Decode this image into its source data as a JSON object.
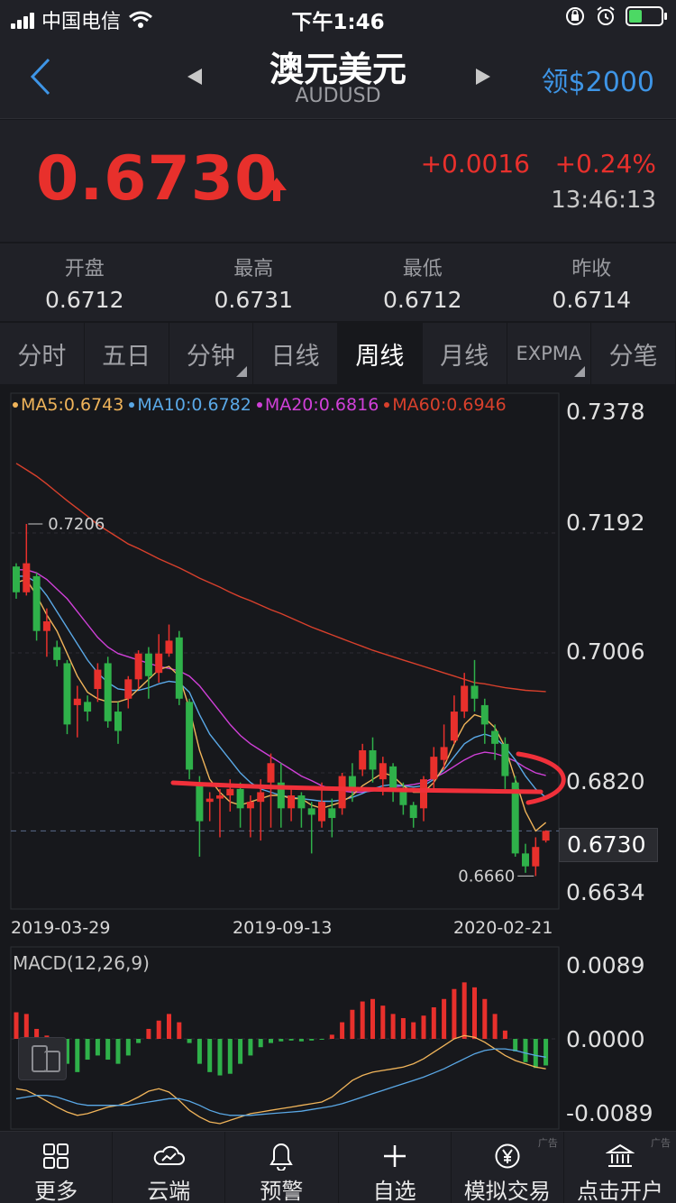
{
  "status": {
    "carrier": "中国电信",
    "time": "下午1:46"
  },
  "nav": {
    "title": "澳元美元",
    "symbol": "AUDUSD",
    "reward": "领$2000"
  },
  "quote": {
    "price": "0.6730",
    "change": "+0.0016",
    "change_pct": "+0.24%",
    "time": "13:46:13"
  },
  "stats": [
    {
      "label": "开盘",
      "value": "0.6712"
    },
    {
      "label": "最高",
      "value": "0.6731"
    },
    {
      "label": "最低",
      "value": "0.6712"
    },
    {
      "label": "昨收",
      "value": "0.6714"
    }
  ],
  "tabs": [
    "分时",
    "五日",
    "分钟",
    "日线",
    "周线",
    "月线",
    "EXPMA",
    "分笔"
  ],
  "active_tab": "周线",
  "legend": [
    {
      "text": "MA5:0.6743",
      "color": "#f0b45a"
    },
    {
      "text": "MA10:0.6782",
      "color": "#5aa8e6"
    },
    {
      "text": "MA20:0.6816",
      "color": "#d040d8"
    },
    {
      "text": "MA60:0.6946",
      "color": "#d8402c"
    }
  ],
  "chart_data": {
    "type": "candlestick",
    "price_axis": [
      "0.7378",
      "0.7192",
      "0.7006",
      "0.6820",
      "0.6730",
      "0.6634"
    ],
    "ylim": [
      0.6634,
      0.7378
    ],
    "date_axis": [
      "2019-03-29",
      "2019-09-13",
      "2020-02-21"
    ],
    "max_label": "0.7206",
    "min_label": "0.6660",
    "last_price": 0.673,
    "macd_title": "MACD(12,26,9)",
    "macd_axis": [
      "0.0089",
      "0.0000",
      "-0.0089"
    ],
    "candles": [
      [
        0.714,
        0.71,
        0.7145,
        0.709
      ],
      [
        0.71,
        0.7145,
        0.7206,
        0.7095
      ],
      [
        0.7125,
        0.704,
        0.713,
        0.7025
      ],
      [
        0.704,
        0.7055,
        0.7075,
        0.7
      ],
      [
        0.7015,
        0.6995,
        0.7025,
        0.6985
      ],
      [
        0.699,
        0.6895,
        0.6995,
        0.688
      ],
      [
        0.6925,
        0.6935,
        0.6955,
        0.6875
      ],
      [
        0.693,
        0.6915,
        0.694,
        0.69
      ],
      [
        0.695,
        0.698,
        0.699,
        0.693
      ],
      [
        0.699,
        0.69,
        0.7,
        0.689
      ],
      [
        0.6915,
        0.6885,
        0.693,
        0.6865
      ],
      [
        0.6935,
        0.6965,
        0.697,
        0.692
      ],
      [
        0.6965,
        0.7005,
        0.701,
        0.695
      ],
      [
        0.7005,
        0.697,
        0.7015,
        0.6935
      ],
      [
        0.6975,
        0.7005,
        0.7035,
        0.696
      ],
      [
        0.7005,
        0.7025,
        0.705,
        0.7
      ],
      [
        0.703,
        0.6935,
        0.704,
        0.6925
      ],
      [
        0.693,
        0.6825,
        0.6935,
        0.681
      ],
      [
        0.68,
        0.6745,
        0.6815,
        0.669
      ],
      [
        0.6775,
        0.678,
        0.679,
        0.6745
      ],
      [
        0.678,
        0.6785,
        0.6795,
        0.672
      ],
      [
        0.6785,
        0.6795,
        0.681,
        0.676
      ],
      [
        0.6795,
        0.6765,
        0.6805,
        0.6735
      ],
      [
        0.6765,
        0.6775,
        0.6785,
        0.672
      ],
      [
        0.6775,
        0.679,
        0.681,
        0.6715
      ],
      [
        0.6805,
        0.6835,
        0.685,
        0.6735
      ],
      [
        0.6805,
        0.6765,
        0.6835,
        0.6735
      ],
      [
        0.6765,
        0.6785,
        0.68,
        0.6745
      ],
      [
        0.6785,
        0.6765,
        0.679,
        0.6735
      ],
      [
        0.6765,
        0.6755,
        0.6775,
        0.6695
      ],
      [
        0.6745,
        0.6775,
        0.6805,
        0.6735
      ],
      [
        0.6765,
        0.675,
        0.678,
        0.672
      ],
      [
        0.6765,
        0.6815,
        0.682,
        0.6755
      ],
      [
        0.6815,
        0.6795,
        0.6835,
        0.6775
      ],
      [
        0.6825,
        0.6855,
        0.6865,
        0.6815
      ],
      [
        0.6855,
        0.6825,
        0.6875,
        0.6805
      ],
      [
        0.681,
        0.6835,
        0.6845,
        0.6785
      ],
      [
        0.683,
        0.6795,
        0.6835,
        0.6775
      ],
      [
        0.6795,
        0.677,
        0.6805,
        0.6755
      ],
      [
        0.677,
        0.675,
        0.6775,
        0.6735
      ],
      [
        0.6765,
        0.681,
        0.6815,
        0.6745
      ],
      [
        0.681,
        0.6845,
        0.686,
        0.6795
      ],
      [
        0.684,
        0.686,
        0.6895,
        0.6825
      ],
      [
        0.687,
        0.6915,
        0.694,
        0.6865
      ],
      [
        0.6915,
        0.6955,
        0.6975,
        0.6905
      ],
      [
        0.6955,
        0.6935,
        0.6995,
        0.6915
      ],
      [
        0.6925,
        0.6895,
        0.6935,
        0.6865
      ],
      [
        0.6885,
        0.6865,
        0.6895,
        0.684
      ],
      [
        0.6865,
        0.6815,
        0.6875,
        0.6795
      ],
      [
        0.6805,
        0.6695,
        0.6815,
        0.669
      ],
      [
        0.6695,
        0.6675,
        0.671,
        0.6665
      ],
      [
        0.6675,
        0.6705,
        0.672,
        0.666
      ],
      [
        0.6715,
        0.673,
        0.6731,
        0.6712
      ]
    ],
    "ma5": [
      0.7115,
      0.712,
      0.7095,
      0.7065,
      0.704,
      0.7005,
      0.697,
      0.6945,
      0.6935,
      0.693,
      0.693,
      0.6935,
      0.695,
      0.6965,
      0.698,
      0.6985,
      0.697,
      0.692,
      0.6855,
      0.681,
      0.679,
      0.6775,
      0.677,
      0.6775,
      0.678,
      0.6785,
      0.6785,
      0.678,
      0.678,
      0.677,
      0.6765,
      0.677,
      0.6775,
      0.6785,
      0.68,
      0.681,
      0.682,
      0.6815,
      0.68,
      0.679,
      0.679,
      0.6805,
      0.683,
      0.6865,
      0.6895,
      0.691,
      0.6905,
      0.689,
      0.686,
      0.681,
      0.676,
      0.673,
      0.6743
    ],
    "ma10": [
      0.7125,
      0.7125,
      0.7115,
      0.7095,
      0.707,
      0.7045,
      0.702,
      0.6995,
      0.6975,
      0.696,
      0.695,
      0.6948,
      0.6948,
      0.6952,
      0.6958,
      0.6962,
      0.696,
      0.6945,
      0.691,
      0.688,
      0.686,
      0.684,
      0.682,
      0.6805,
      0.6795,
      0.679,
      0.6785,
      0.6782,
      0.678,
      0.6778,
      0.6776,
      0.6776,
      0.6778,
      0.6782,
      0.6788,
      0.6795,
      0.68,
      0.6802,
      0.68,
      0.6798,
      0.68,
      0.681,
      0.6825,
      0.6845,
      0.6865,
      0.6875,
      0.688,
      0.6875,
      0.686,
      0.684,
      0.6815,
      0.6795,
      0.6782
    ],
    "ma20": [
      0.7135,
      0.7135,
      0.713,
      0.712,
      0.7105,
      0.709,
      0.707,
      0.705,
      0.703,
      0.7015,
      0.7005,
      0.7,
      0.6995,
      0.699,
      0.6985,
      0.6982,
      0.6978,
      0.697,
      0.6955,
      0.6935,
      0.6915,
      0.6895,
      0.6878,
      0.6865,
      0.6855,
      0.6845,
      0.6835,
      0.6825,
      0.6815,
      0.6808,
      0.68,
      0.6795,
      0.6792,
      0.679,
      0.679,
      0.6792,
      0.6795,
      0.6798,
      0.68,
      0.6802,
      0.6805,
      0.6812,
      0.682,
      0.683,
      0.684,
      0.6848,
      0.6852,
      0.685,
      0.6845,
      0.6838,
      0.6828,
      0.682,
      0.6816
    ],
    "ma60": [
      0.73,
      0.729,
      0.728,
      0.7268,
      0.7255,
      0.7242,
      0.723,
      0.7218,
      0.7205,
      0.7195,
      0.7185,
      0.7175,
      0.7168,
      0.716,
      0.7152,
      0.7145,
      0.7138,
      0.713,
      0.7122,
      0.7115,
      0.7108,
      0.71,
      0.7093,
      0.7087,
      0.708,
      0.7073,
      0.7067,
      0.706,
      0.7053,
      0.7046,
      0.704,
      0.7034,
      0.7028,
      0.7022,
      0.7016,
      0.701,
      0.7005,
      0.7,
      0.6995,
      0.699,
      0.6985,
      0.698,
      0.6975,
      0.697,
      0.6965,
      0.696,
      0.6958,
      0.6955,
      0.6952,
      0.695,
      0.6948,
      0.6947,
      0.6946
    ],
    "macd_hist": [
      0.0032,
      0.003,
      0.0012,
      0.0004,
      -0.001,
      -0.003,
      -0.004,
      -0.0025,
      -0.002,
      -0.0025,
      -0.003,
      -0.002,
      -0.0005,
      0.0012,
      0.0022,
      0.003,
      0.002,
      -0.0005,
      -0.003,
      -0.004,
      -0.0044,
      -0.0042,
      -0.003,
      -0.002,
      -0.001,
      -0.0005,
      -0.0003,
      -0.0002,
      -0.0003,
      -0.0002,
      -0.0001,
      0.0005,
      0.002,
      0.0035,
      0.0045,
      0.0048,
      0.004,
      0.003,
      0.0025,
      0.002,
      0.0028,
      0.0038,
      0.0048,
      0.006,
      0.0068,
      0.0062,
      0.0048,
      0.003,
      0.001,
      -0.0015,
      -0.0028,
      -0.0035,
      -0.0032
    ],
    "dif": [
      -0.006,
      -0.0062,
      -0.0068,
      -0.0075,
      -0.0082,
      -0.0088,
      -0.0092,
      -0.009,
      -0.0086,
      -0.0082,
      -0.008,
      -0.0076,
      -0.007,
      -0.0063,
      -0.006,
      -0.0064,
      -0.0074,
      -0.0086,
      -0.0094,
      -0.01,
      -0.0102,
      -0.0098,
      -0.0094,
      -0.009,
      -0.0088,
      -0.0086,
      -0.0084,
      -0.0082,
      -0.008,
      -0.0078,
      -0.0076,
      -0.007,
      -0.006,
      -0.005,
      -0.0044,
      -0.004,
      -0.0038,
      -0.0036,
      -0.0034,
      -0.003,
      -0.0024,
      -0.0016,
      -0.0008,
      0.0,
      0.0004,
      0.0002,
      -0.0004,
      -0.0012,
      -0.002,
      -0.0026,
      -0.003,
      -0.0034,
      -0.0036
    ],
    "dea": [
      -0.0072,
      -0.007,
      -0.0068,
      -0.0068,
      -0.007,
      -0.0074,
      -0.0078,
      -0.008,
      -0.008,
      -0.008,
      -0.008,
      -0.008,
      -0.0078,
      -0.0076,
      -0.0074,
      -0.0072,
      -0.0072,
      -0.0075,
      -0.008,
      -0.0086,
      -0.009,
      -0.0092,
      -0.0092,
      -0.0092,
      -0.0091,
      -0.009,
      -0.0089,
      -0.0088,
      -0.0087,
      -0.0085,
      -0.0083,
      -0.0081,
      -0.0078,
      -0.0074,
      -0.007,
      -0.0066,
      -0.0062,
      -0.0058,
      -0.0054,
      -0.005,
      -0.0046,
      -0.0041,
      -0.0036,
      -0.003,
      -0.0024,
      -0.0018,
      -0.0014,
      -0.0012,
      -0.0012,
      -0.0014,
      -0.0017,
      -0.002,
      -0.0022
    ]
  },
  "bottom": [
    {
      "label": "更多",
      "icon": "grid-icon",
      "ad": ""
    },
    {
      "label": "云端",
      "icon": "cloud-icon",
      "ad": ""
    },
    {
      "label": "预警",
      "icon": "bell-icon",
      "ad": ""
    },
    {
      "label": "自选",
      "icon": "plus-icon",
      "ad": ""
    },
    {
      "label": "模拟交易",
      "icon": "yen-icon",
      "ad": "广告"
    },
    {
      "label": "点击开户",
      "icon": "bank-icon",
      "ad": "广告"
    }
  ]
}
